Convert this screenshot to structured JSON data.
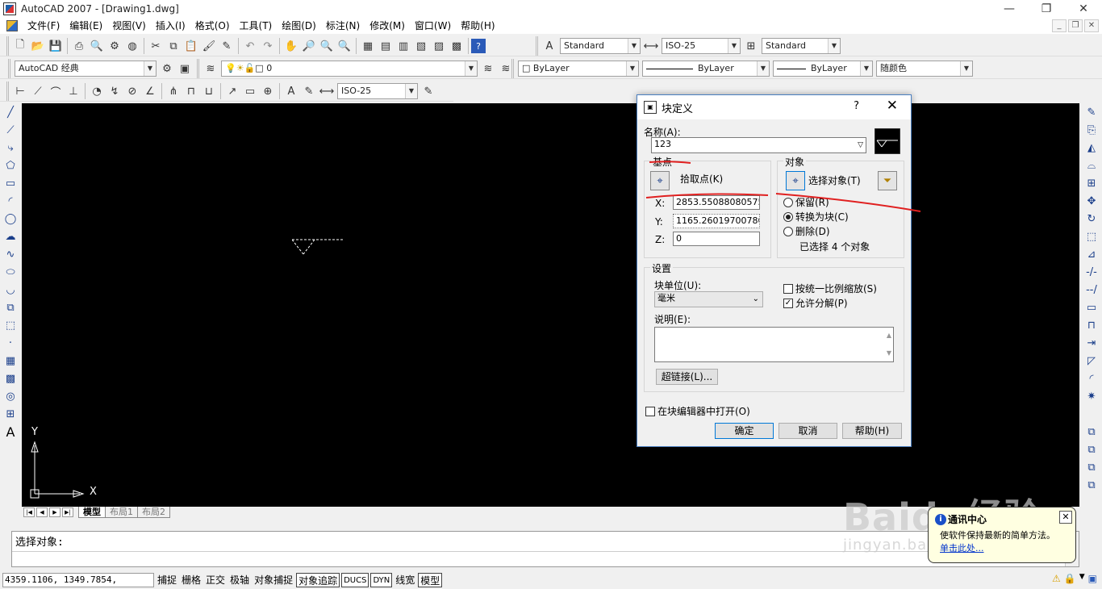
{
  "window": {
    "title": "AutoCAD 2007 - [Drawing1.dwg]",
    "minimize": "—",
    "maximize": "❐",
    "close": "✕"
  },
  "menu": [
    "文件(F)",
    "编辑(E)",
    "视图(V)",
    "插入(I)",
    "格式(O)",
    "工具(T)",
    "绘图(D)",
    "标注(N)",
    "修改(M)",
    "窗口(W)",
    "帮助(H)"
  ],
  "toolbar1": {
    "text_style": "Standard",
    "dim_style": "ISO-25",
    "table_style": "Standard"
  },
  "toolbar2": {
    "workspace": "AutoCAD 经典",
    "layer": "0",
    "color": "ByLayer",
    "linetype": "ByLayer",
    "lineweight": "ByLayer",
    "plot_style": "随颜色"
  },
  "toolbar3": {
    "dim_style": "ISO-25"
  },
  "layout_tabs": [
    "模型",
    "布局1",
    "布局2"
  ],
  "ucs": {
    "x_label": "X",
    "y_label": "Y"
  },
  "command": {
    "prompt": "选择对象:"
  },
  "status": {
    "coords": "4359.1106, 1349.7854, 0.0000",
    "buttons": [
      {
        "label": "捕捉",
        "on": false
      },
      {
        "label": "栅格",
        "on": false
      },
      {
        "label": "正交",
        "on": false
      },
      {
        "label": "极轴",
        "on": false
      },
      {
        "label": "对象捕捉",
        "on": false
      },
      {
        "label": "对象追踪",
        "on": true
      },
      {
        "label": "DUCS",
        "on": true
      },
      {
        "label": "DYN",
        "on": true
      },
      {
        "label": "线宽",
        "on": false
      },
      {
        "label": "模型",
        "on": true
      }
    ]
  },
  "balloon": {
    "title": "通讯中心",
    "body": "使软件保持最新的简单方法。",
    "link": "单击此处..."
  },
  "watermark": {
    "main": "Baidu经验",
    "sub": "jingyan.baidu.com"
  },
  "dialog": {
    "title": "块定义",
    "help": "?",
    "close": "✕",
    "name_label": "名称(A):",
    "name_value": "123",
    "base_point": {
      "group": "基点",
      "pick_label": "拾取点(K)",
      "x_label": "X:",
      "x_value": "2853.55088080575",
      "y_label": "Y:",
      "y_value": "1165.260197007806",
      "z_label": "Z:",
      "z_value": "0"
    },
    "objects": {
      "group": "对象",
      "select_label": "选择对象(T)",
      "retain": "保留(R)",
      "convert": "转换为块(C)",
      "delete": "删除(D)",
      "selected_count": "已选择 4 个对象"
    },
    "settings": {
      "group": "设置",
      "units_label": "块单位(U):",
      "units_value": "毫米",
      "uniform_scale": "按统一比例缩放(S)",
      "allow_explode": "允许分解(P)",
      "description_label": "说明(E):",
      "hyperlink": "超链接(L)..."
    },
    "open_in_editor": "在块编辑器中打开(O)",
    "ok": "确定",
    "cancel": "取消",
    "help_btn": "帮助(H)"
  },
  "colors": {
    "canvas": "#000000",
    "annotation": "#e02020",
    "dialog_border": "#4a7fc0"
  }
}
